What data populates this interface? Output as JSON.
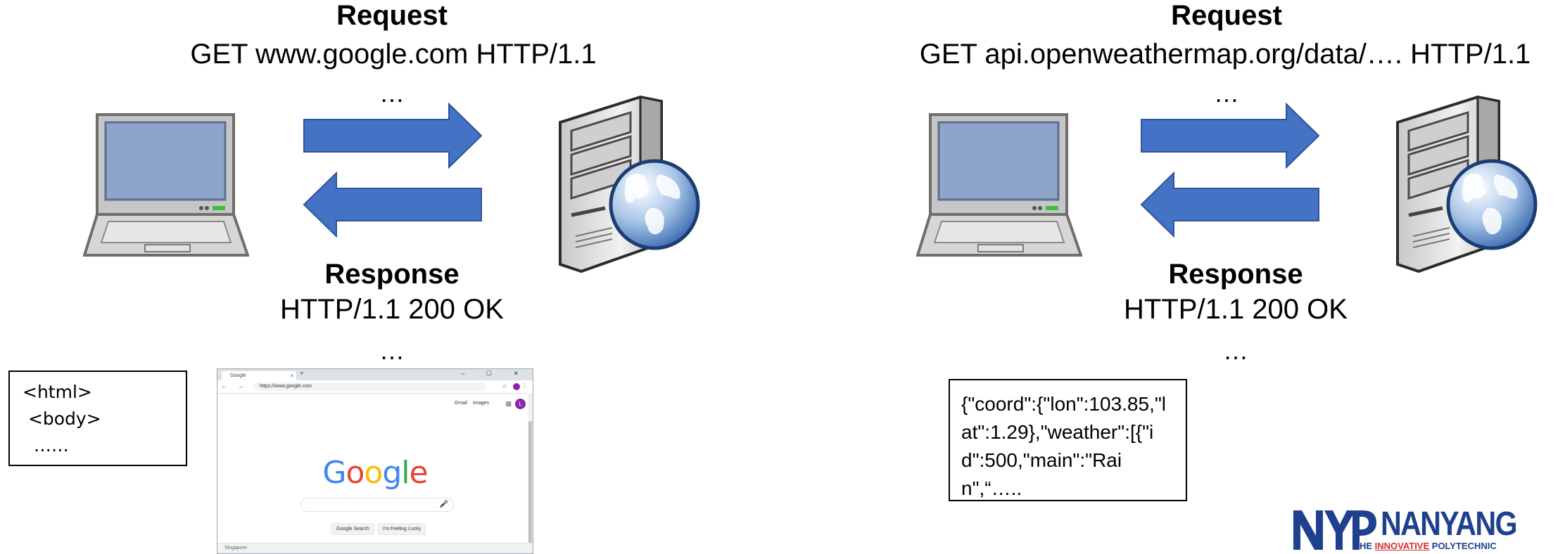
{
  "left": {
    "request_heading": "Request",
    "request_line": "GET www.google.com HTTP/1.1",
    "request_dots": "…",
    "response_heading": "Response",
    "response_line": "HTTP/1.1 200 OK",
    "response_dots": "…",
    "html_box": "<html>\n <body>\n  ……",
    "browser": {
      "tab_title": "Google",
      "tab_close": "×",
      "new_tab": "+",
      "window_controls": "– ☐ ✕",
      "nav": "← → C",
      "url": "https://www.google.com",
      "top_links": "Gmail Images",
      "avatar_letter": "L",
      "logo": "Google",
      "search_button": "Google Search",
      "lucky_button": "I'm Feeling Lucky",
      "footer": "Singapore"
    }
  },
  "right": {
    "request_heading": "Request",
    "request_line": "GET api.openweathermap.org/data/…. HTTP/1.1",
    "request_dots": "…",
    "response_heading": "Response",
    "response_line": "HTTP/1.1 200 OK",
    "response_dots": "…",
    "json_box": "{\"coord\":{\"lon\":103.85,\"lat\":1.29},\"weather\":[{\"id\":500,\"main\":\"Rain\",“….."
  },
  "logo": {
    "brand": "NANYANG",
    "tag_prefix": "THE ",
    "tag_highlight": "INNOVATIVE",
    "tag_suffix": " POLYTECHNIC"
  },
  "colors": {
    "arrow": "#4472c4",
    "laptop_screen": "#8ea4c8",
    "laptop_body": "#d6d6d6",
    "logo_blue": "#1f3f8f",
    "logo_red": "#d0312d",
    "google_blue": "#4285f4",
    "google_red": "#ea4335",
    "google_yellow": "#fbbc05",
    "google_green": "#34a853"
  }
}
